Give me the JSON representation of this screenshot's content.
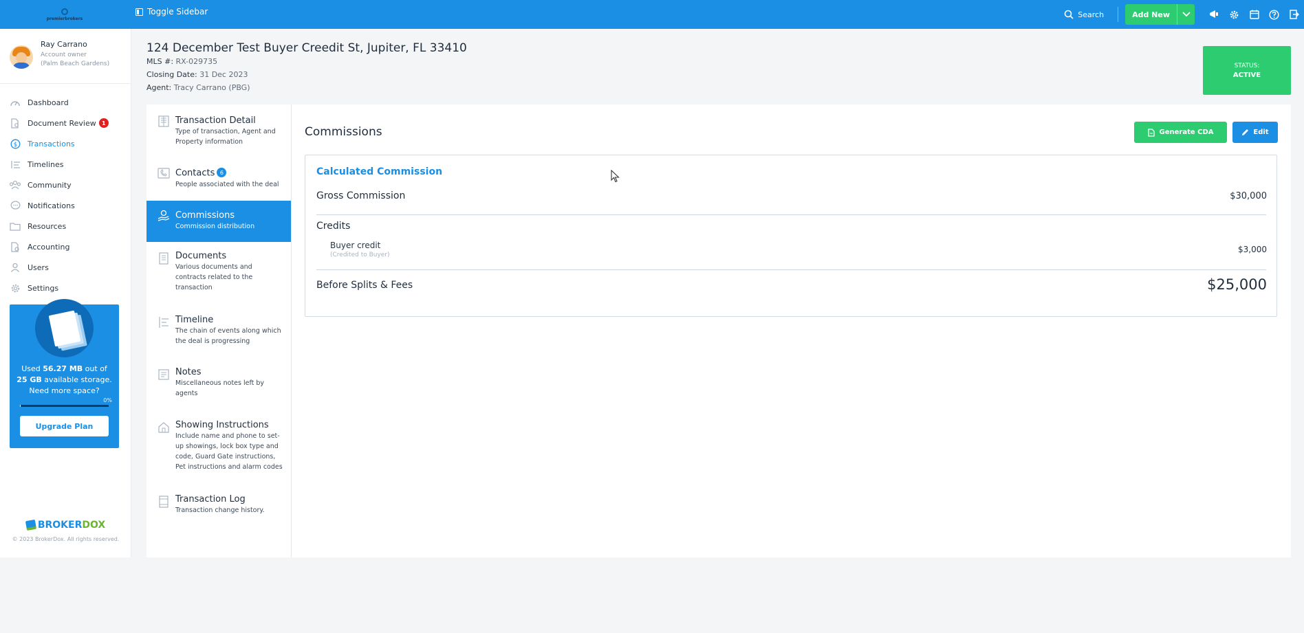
{
  "topbar": {
    "logo_text": "premierbrokers",
    "toggle_label": "Toggle Sidebar",
    "search_label": "Search",
    "add_new_label": "Add New",
    "icons": [
      "megaphone-icon",
      "gear-icon",
      "calendar-icon",
      "help-icon",
      "logout-icon"
    ]
  },
  "user": {
    "name": "Ray Carrano",
    "role": "Account owner",
    "office": "(Palm Beach Gardens)"
  },
  "nav": {
    "items": [
      {
        "label": "Dashboard",
        "icon": "dashboard-icon"
      },
      {
        "label": "Document Review",
        "icon": "document-review-icon",
        "badge": "1"
      },
      {
        "label": "Transactions",
        "icon": "dollar-icon",
        "active": true
      },
      {
        "label": "Timelines",
        "icon": "timeline-icon"
      },
      {
        "label": "Community",
        "icon": "community-icon"
      },
      {
        "label": "Notifications",
        "icon": "chat-icon"
      },
      {
        "label": "Resources",
        "icon": "resources-icon"
      },
      {
        "label": "Accounting",
        "icon": "accounting-icon"
      },
      {
        "label": "Users",
        "icon": "user-icon"
      },
      {
        "label": "Settings",
        "icon": "gear-icon"
      }
    ]
  },
  "storage": {
    "used_prefix": "Used ",
    "used": "56.27 MB",
    "out_of": " out of ",
    "total": "25 GB",
    "suffix": " available storage. Need more space?",
    "percent": "0%",
    "percent_fraction": 0.002,
    "upgrade_label": "Upgrade Plan"
  },
  "footer": {
    "brand_part1": "BROKER",
    "brand_part2": "DOX",
    "copyright": "© 2023 BrokerDox. All rights reserved."
  },
  "transaction": {
    "address": "124 December Test Buyer Creedit St, Jupiter, FL 33410",
    "mls_label": "MLS #:",
    "mls_value": "RX-029735",
    "closing_label": "Closing Date:",
    "closing_value": "31 Dec 2023",
    "agent_label": "Agent:",
    "agent_value": "Tracy Carrano (PBG)",
    "status_label": "STATUS:",
    "status_value": "ACTIVE"
  },
  "sections": [
    {
      "title": "Transaction Detail",
      "desc": "Type of transaction, Agent and Property information",
      "icon": "building-icon"
    },
    {
      "title": "Contacts",
      "desc": "People associated with the deal",
      "icon": "phone-icon",
      "badge": "6"
    },
    {
      "title": "Commissions",
      "desc": "Commission distribution",
      "icon": "commission-icon",
      "active": true
    },
    {
      "title": "Documents",
      "desc": "Various documents and contracts related to the transaction",
      "icon": "document-icon"
    },
    {
      "title": "Timeline",
      "desc": "The chain of events along which the deal is progressing",
      "icon": "timeline-icon"
    },
    {
      "title": "Notes",
      "desc": "Miscellaneous notes left by agents",
      "icon": "notes-icon"
    },
    {
      "title": "Showing Instructions",
      "desc": "Include name and phone to set-up showings, lock box type and code, Guard Gate instructions, Pet instructions and alarm codes",
      "icon": "house-icon"
    },
    {
      "title": "Transaction Log",
      "desc": "Transaction change history.",
      "icon": "log-icon"
    }
  ],
  "commissions": {
    "title": "Commissions",
    "generate_cda_label": "Generate CDA",
    "edit_label": "Edit",
    "card_title": "Calculated Commission",
    "gross_label": "Gross Commission",
    "gross_value": "$30,000",
    "credits_label": "Credits",
    "buyer_credit_label": "Buyer credit",
    "buyer_credit_note": "(Credited to Buyer)",
    "buyer_credit_value": "$3,000",
    "before_splits_label": "Before Splits & Fees",
    "before_splits_value": "$25,000"
  },
  "colors": {
    "primary": "#1a8fe3",
    "success": "#2ecc71",
    "badge_red": "#e02020"
  }
}
